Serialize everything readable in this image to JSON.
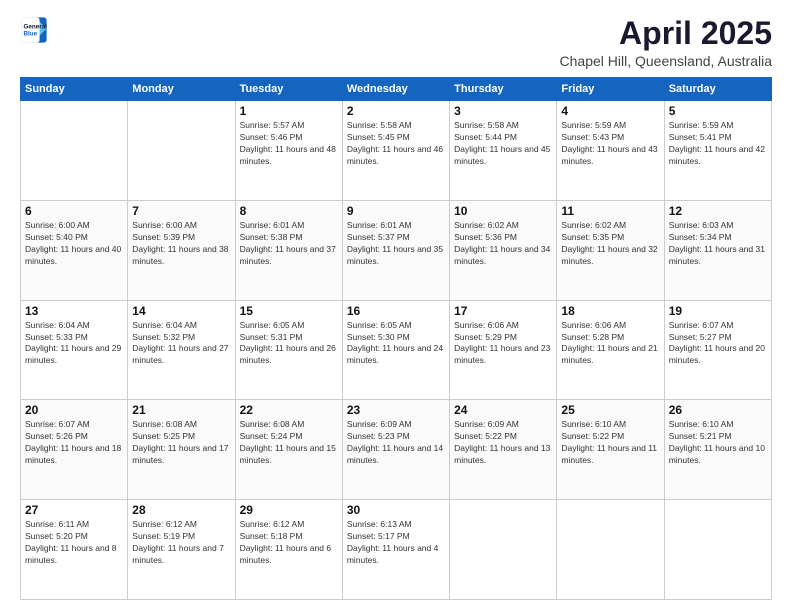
{
  "logo": {
    "line1": "General",
    "line2": "Blue"
  },
  "title": "April 2025",
  "subtitle": "Chapel Hill, Queensland, Australia",
  "headers": [
    "Sunday",
    "Monday",
    "Tuesday",
    "Wednesday",
    "Thursday",
    "Friday",
    "Saturday"
  ],
  "weeks": [
    [
      {
        "day": "",
        "info": ""
      },
      {
        "day": "",
        "info": ""
      },
      {
        "day": "1",
        "info": "Sunrise: 5:57 AM\nSunset: 5:46 PM\nDaylight: 11 hours and 48 minutes."
      },
      {
        "day": "2",
        "info": "Sunrise: 5:58 AM\nSunset: 5:45 PM\nDaylight: 11 hours and 46 minutes."
      },
      {
        "day": "3",
        "info": "Sunrise: 5:58 AM\nSunset: 5:44 PM\nDaylight: 11 hours and 45 minutes."
      },
      {
        "day": "4",
        "info": "Sunrise: 5:59 AM\nSunset: 5:43 PM\nDaylight: 11 hours and 43 minutes."
      },
      {
        "day": "5",
        "info": "Sunrise: 5:59 AM\nSunset: 5:41 PM\nDaylight: 11 hours and 42 minutes."
      }
    ],
    [
      {
        "day": "6",
        "info": "Sunrise: 6:00 AM\nSunset: 5:40 PM\nDaylight: 11 hours and 40 minutes."
      },
      {
        "day": "7",
        "info": "Sunrise: 6:00 AM\nSunset: 5:39 PM\nDaylight: 11 hours and 38 minutes."
      },
      {
        "day": "8",
        "info": "Sunrise: 6:01 AM\nSunset: 5:38 PM\nDaylight: 11 hours and 37 minutes."
      },
      {
        "day": "9",
        "info": "Sunrise: 6:01 AM\nSunset: 5:37 PM\nDaylight: 11 hours and 35 minutes."
      },
      {
        "day": "10",
        "info": "Sunrise: 6:02 AM\nSunset: 5:36 PM\nDaylight: 11 hours and 34 minutes."
      },
      {
        "day": "11",
        "info": "Sunrise: 6:02 AM\nSunset: 5:35 PM\nDaylight: 11 hours and 32 minutes."
      },
      {
        "day": "12",
        "info": "Sunrise: 6:03 AM\nSunset: 5:34 PM\nDaylight: 11 hours and 31 minutes."
      }
    ],
    [
      {
        "day": "13",
        "info": "Sunrise: 6:04 AM\nSunset: 5:33 PM\nDaylight: 11 hours and 29 minutes."
      },
      {
        "day": "14",
        "info": "Sunrise: 6:04 AM\nSunset: 5:32 PM\nDaylight: 11 hours and 27 minutes."
      },
      {
        "day": "15",
        "info": "Sunrise: 6:05 AM\nSunset: 5:31 PM\nDaylight: 11 hours and 26 minutes."
      },
      {
        "day": "16",
        "info": "Sunrise: 6:05 AM\nSunset: 5:30 PM\nDaylight: 11 hours and 24 minutes."
      },
      {
        "day": "17",
        "info": "Sunrise: 6:06 AM\nSunset: 5:29 PM\nDaylight: 11 hours and 23 minutes."
      },
      {
        "day": "18",
        "info": "Sunrise: 6:06 AM\nSunset: 5:28 PM\nDaylight: 11 hours and 21 minutes."
      },
      {
        "day": "19",
        "info": "Sunrise: 6:07 AM\nSunset: 5:27 PM\nDaylight: 11 hours and 20 minutes."
      }
    ],
    [
      {
        "day": "20",
        "info": "Sunrise: 6:07 AM\nSunset: 5:26 PM\nDaylight: 11 hours and 18 minutes."
      },
      {
        "day": "21",
        "info": "Sunrise: 6:08 AM\nSunset: 5:25 PM\nDaylight: 11 hours and 17 minutes."
      },
      {
        "day": "22",
        "info": "Sunrise: 6:08 AM\nSunset: 5:24 PM\nDaylight: 11 hours and 15 minutes."
      },
      {
        "day": "23",
        "info": "Sunrise: 6:09 AM\nSunset: 5:23 PM\nDaylight: 11 hours and 14 minutes."
      },
      {
        "day": "24",
        "info": "Sunrise: 6:09 AM\nSunset: 5:22 PM\nDaylight: 11 hours and 13 minutes."
      },
      {
        "day": "25",
        "info": "Sunrise: 6:10 AM\nSunset: 5:22 PM\nDaylight: 11 hours and 11 minutes."
      },
      {
        "day": "26",
        "info": "Sunrise: 6:10 AM\nSunset: 5:21 PM\nDaylight: 11 hours and 10 minutes."
      }
    ],
    [
      {
        "day": "27",
        "info": "Sunrise: 6:11 AM\nSunset: 5:20 PM\nDaylight: 11 hours and 8 minutes."
      },
      {
        "day": "28",
        "info": "Sunrise: 6:12 AM\nSunset: 5:19 PM\nDaylight: 11 hours and 7 minutes."
      },
      {
        "day": "29",
        "info": "Sunrise: 6:12 AM\nSunset: 5:18 PM\nDaylight: 11 hours and 6 minutes."
      },
      {
        "day": "30",
        "info": "Sunrise: 6:13 AM\nSunset: 5:17 PM\nDaylight: 11 hours and 4 minutes."
      },
      {
        "day": "",
        "info": ""
      },
      {
        "day": "",
        "info": ""
      },
      {
        "day": "",
        "info": ""
      }
    ]
  ]
}
